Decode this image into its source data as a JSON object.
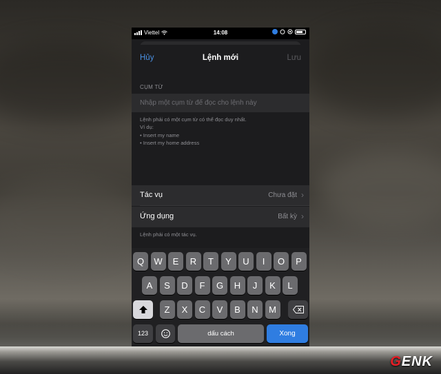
{
  "status_bar": {
    "carrier": "Viettel",
    "time": "14:08"
  },
  "navbar": {
    "cancel_label": "Hủy",
    "title": "Lệnh mới",
    "save_label": "Lưu"
  },
  "phrase_section": {
    "header": "CỤM TỪ",
    "input_value": "",
    "input_placeholder": "Nhập một cụm từ để đọc cho lệnh này",
    "footer_lines": [
      "Lệnh phải có một cụm từ có thể đọc duy nhất.",
      "Ví dụ:",
      "• Insert my name",
      "• Insert my home address"
    ]
  },
  "settings": [
    {
      "label": "Tác vụ",
      "value": "Chưa đặt"
    },
    {
      "label": "Ứng dụng",
      "value": "Bất kỳ"
    }
  ],
  "settings_footer": "Lệnh phải có một tác vụ.",
  "keyboard": {
    "row1": [
      "Q",
      "W",
      "E",
      "R",
      "T",
      "Y",
      "U",
      "I",
      "O",
      "P"
    ],
    "row2": [
      "A",
      "S",
      "D",
      "F",
      "G",
      "H",
      "J",
      "K",
      "L"
    ],
    "row3": [
      "Z",
      "X",
      "C",
      "V",
      "B",
      "N",
      "M"
    ],
    "numbers_label": "123",
    "space_label": "dấu cách",
    "return_label": "Xong",
    "shift_icon": "shift-arrow-icon",
    "delete_icon": "backspace-icon",
    "emoji_icon": "emoji-icon"
  },
  "watermark": "GENK",
  "colors": {
    "accent_blue": "#4a90e2",
    "return_key": "#2f7de1",
    "brand_red": "#e61e26"
  }
}
